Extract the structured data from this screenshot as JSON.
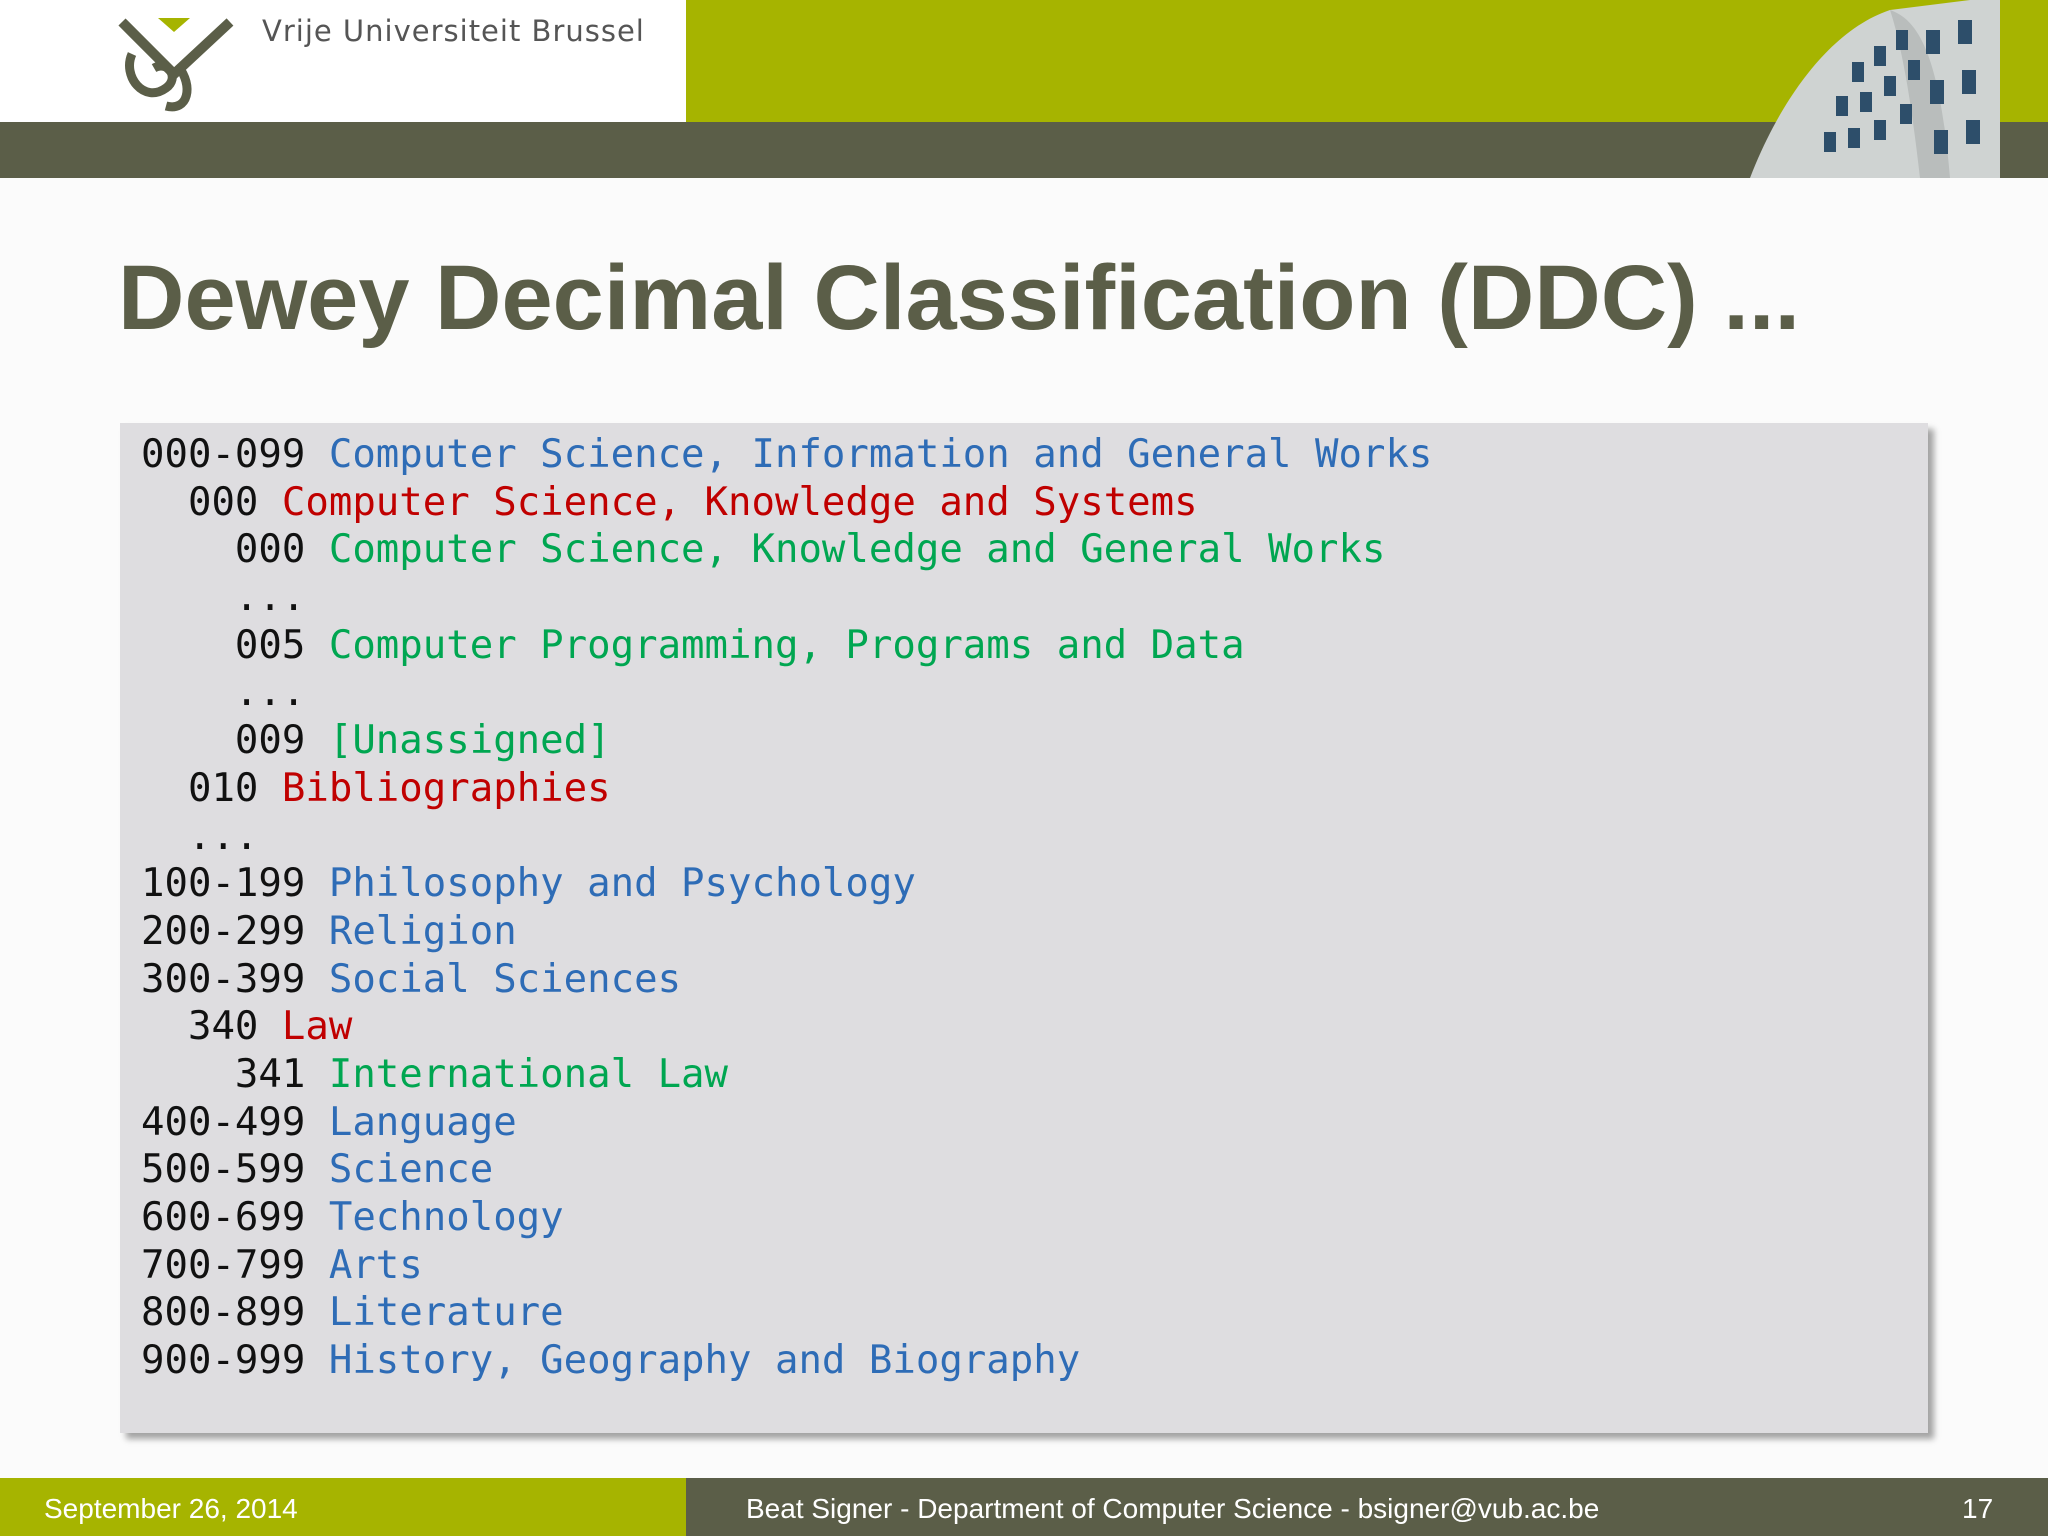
{
  "header": {
    "university_name": "Vrije Universiteit  Brussel",
    "logo_icon": "vub-logo-icon",
    "photo_icon": "building-photo-icon",
    "colors": {
      "green": "#a6b400",
      "dark": "#5b5e48"
    }
  },
  "slide": {
    "title": "Dewey Decimal Classification (DDC) ...",
    "colors": {
      "top_level": "#2e6cb6",
      "second_level": "#c00000",
      "third_level": "#00a651",
      "code_box": "#dedde0"
    },
    "lines": [
      {
        "code": "000-099 ",
        "label": "Computer Science, Information and General Works",
        "level": "top"
      },
      {
        "code": "  000 ",
        "label": "Computer Science, Knowledge and Systems",
        "level": "mid"
      },
      {
        "code": "    000 ",
        "label": "Computer Science, Knowledge and General Works",
        "level": "low"
      },
      {
        "code": "    ...",
        "label": "",
        "level": "low"
      },
      {
        "code": "    005 ",
        "label": "Computer Programming, Programs and Data",
        "level": "low"
      },
      {
        "code": "    ...",
        "label": "",
        "level": "low"
      },
      {
        "code": "    009 ",
        "label": "[Unassigned]",
        "level": "low"
      },
      {
        "code": "  010 ",
        "label": "Bibliographies",
        "level": "mid"
      },
      {
        "code": "  ...",
        "label": "",
        "level": "mid"
      },
      {
        "code": "100-199 ",
        "label": "Philosophy and Psychology",
        "level": "top"
      },
      {
        "code": "200-299 ",
        "label": "Religion",
        "level": "top"
      },
      {
        "code": "300-399 ",
        "label": "Social Sciences",
        "level": "top"
      },
      {
        "code": "  340 ",
        "label": "Law",
        "level": "mid"
      },
      {
        "code": "    341 ",
        "label": "International Law",
        "level": "low"
      },
      {
        "code": "400-499 ",
        "label": "Language",
        "level": "top"
      },
      {
        "code": "500-599 ",
        "label": "Science",
        "level": "top"
      },
      {
        "code": "600-699 ",
        "label": "Technology",
        "level": "top"
      },
      {
        "code": "700-799 ",
        "label": "Arts",
        "level": "top"
      },
      {
        "code": "800-899 ",
        "label": "Literature",
        "level": "top"
      },
      {
        "code": "900-999 ",
        "label": "History, Geography and Biography",
        "level": "top"
      }
    ]
  },
  "footer": {
    "date": "September 26, 2014",
    "author": "Beat Signer - Department of Computer Science - bsigner@vub.ac.be",
    "page_number": "17"
  }
}
